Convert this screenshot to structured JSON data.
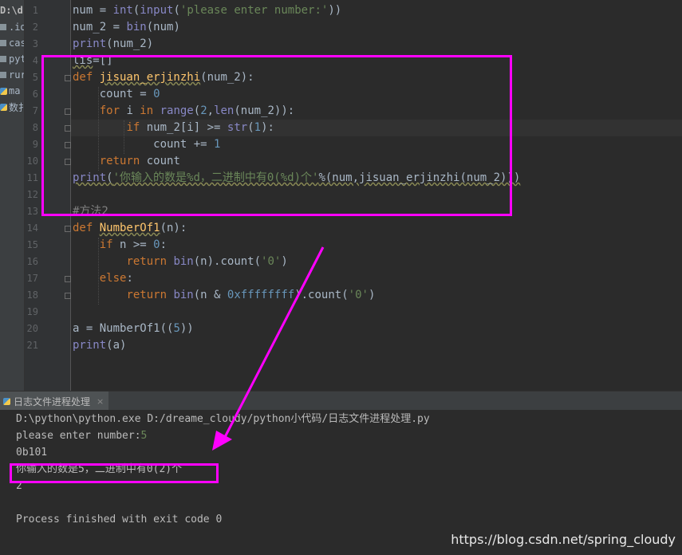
{
  "project_panel": {
    "title": "D:\\dre",
    "items": [
      {
        "label": ".ide",
        "icon": "folder-icon"
      },
      {
        "label": "cas",
        "icon": "folder-icon"
      },
      {
        "label": "pyt",
        "icon": "folder-icon"
      },
      {
        "label": "rur",
        "icon": "folder-icon"
      },
      {
        "label": "ma",
        "icon": "python-file-icon"
      },
      {
        "label": "数扌",
        "icon": "python-file-icon"
      }
    ]
  },
  "editor": {
    "line_numbers": [
      "1",
      "2",
      "3",
      "4",
      "5",
      "6",
      "7",
      "8",
      "9",
      "10",
      "11",
      "12",
      "13",
      "14",
      "15",
      "16",
      "17",
      "18",
      "19",
      "20",
      "21"
    ],
    "current_line": 8,
    "lines": [
      [
        {
          "t": "num = "
        },
        {
          "t": "int",
          "c": "bi"
        },
        {
          "t": "("
        },
        {
          "t": "input",
          "c": "bi"
        },
        {
          "t": "("
        },
        {
          "t": "'please enter number:'",
          "c": "str"
        },
        {
          "t": "))"
        }
      ],
      [
        {
          "t": "num_2 = "
        },
        {
          "t": "bin",
          "c": "bi"
        },
        {
          "t": "(num)"
        }
      ],
      [
        {
          "t": "print",
          "c": "bi"
        },
        {
          "t": "(num_2)"
        }
      ],
      [
        {
          "t": "lis",
          "c": "wv"
        },
        {
          "t": "=[]"
        }
      ],
      [
        {
          "t": "def ",
          "c": "kw"
        },
        {
          "t": "jisuan_erjinzhi",
          "c": "fn wv"
        },
        {
          "t": "(num_2):"
        }
      ],
      [
        {
          "t": "    count = "
        },
        {
          "t": "0",
          "c": "num"
        }
      ],
      [
        {
          "t": "    "
        },
        {
          "t": "for ",
          "c": "kw"
        },
        {
          "t": "i "
        },
        {
          "t": "in ",
          "c": "kw"
        },
        {
          "t": "range",
          "c": "bi"
        },
        {
          "t": "("
        },
        {
          "t": "2",
          "c": "num"
        },
        {
          "t": ","
        },
        {
          "t": "len",
          "c": "bi"
        },
        {
          "t": "(num_2)):"
        }
      ],
      [
        {
          "t": "        "
        },
        {
          "t": "if ",
          "c": "kw"
        },
        {
          "t": "num_2[i] >= "
        },
        {
          "t": "str",
          "c": "bi"
        },
        {
          "t": "("
        },
        {
          "t": "1",
          "c": "num"
        },
        {
          "t": "):"
        }
      ],
      [
        {
          "t": "            count += "
        },
        {
          "t": "1",
          "c": "num"
        }
      ],
      [
        {
          "t": "    "
        },
        {
          "t": "return ",
          "c": "kw"
        },
        {
          "t": "count"
        }
      ],
      [
        {
          "t": "print",
          "c": "bi wv"
        },
        {
          "t": "(",
          "c": "wv"
        },
        {
          "t": "'你输入的数是%d，二进制中有0(%d)个'",
          "c": "str wv"
        },
        {
          "t": "%(num,jisuan_erjinzhi(num_2)))",
          "c": "wv"
        }
      ],
      [],
      [
        {
          "t": "#方法2",
          "c": "cm"
        }
      ],
      [
        {
          "t": "def ",
          "c": "kw"
        },
        {
          "t": "NumberOf1",
          "c": "fn wv"
        },
        {
          "t": "(n):"
        }
      ],
      [
        {
          "t": "    "
        },
        {
          "t": "if ",
          "c": "kw"
        },
        {
          "t": "n >= "
        },
        {
          "t": "0",
          "c": "num"
        },
        {
          "t": ":"
        }
      ],
      [
        {
          "t": "        "
        },
        {
          "t": "return ",
          "c": "kw"
        },
        {
          "t": "bin",
          "c": "bi"
        },
        {
          "t": "(n).count("
        },
        {
          "t": "'0'",
          "c": "str"
        },
        {
          "t": ")"
        }
      ],
      [
        {
          "t": "    "
        },
        {
          "t": "else",
          "c": "kw"
        },
        {
          "t": ":"
        }
      ],
      [
        {
          "t": "        "
        },
        {
          "t": "return ",
          "c": "kw"
        },
        {
          "t": "bin",
          "c": "bi"
        },
        {
          "t": "(n & "
        },
        {
          "t": "0xffffffff",
          "c": "num"
        },
        {
          "t": ").count("
        },
        {
          "t": "'0'",
          "c": "str"
        },
        {
          "t": ")"
        }
      ],
      [],
      [
        {
          "t": "a = NumberOf1(("
        },
        {
          "t": "5",
          "c": "num"
        },
        {
          "t": "))"
        }
      ],
      [
        {
          "t": "print",
          "c": "bi"
        },
        {
          "t": "(a)"
        }
      ]
    ]
  },
  "run_panel": {
    "tab_label": "日志文件进程处理",
    "close_symbol": "×",
    "console_lines": [
      {
        "text": "D:\\python\\python.exe D:/dreame_cloudy/python小代码/日志文件进程处理.py"
      },
      {
        "text": "please enter number:",
        "input": "5"
      },
      {
        "text": "0b101"
      },
      {
        "text": "你输入的数是5，二进制中有0(2)个"
      },
      {
        "text": "2"
      },
      {
        "text": ""
      },
      {
        "text": "Process finished with exit code 0"
      }
    ]
  },
  "annotation_color": "#ff00ff",
  "watermark": "https://blog.csdn.net/spring_cloudy"
}
